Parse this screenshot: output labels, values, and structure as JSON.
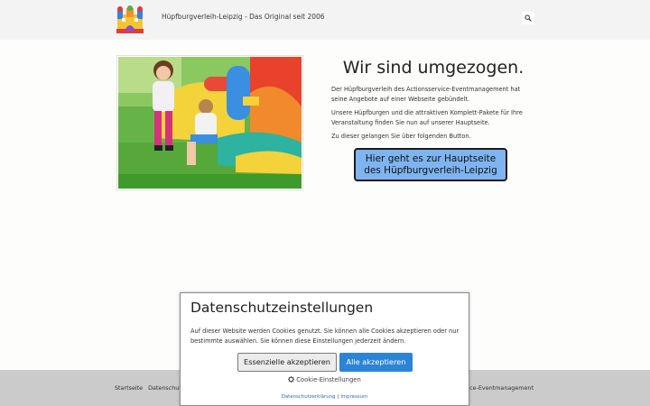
{
  "header": {
    "site_title": "Hüpfburgverleih-Leipzig - Das Original seit 2006",
    "search_icon": "search-icon"
  },
  "main": {
    "image": "bouncy-castle-children-photo",
    "headline": "Wir sind umgezogen.",
    "paragraph1": "Der Hüpfburgverleih des Actionsservice-Eventmanagement hat seine Angebote auf einer Webseite gebündelt.",
    "paragraph2": "Unsere Hüpfburgen und die attraktiven Komplett-Pakete für Ihre Veranstaltung finden Sie nun auf unserer Hauptseite.",
    "paragraph3": "Zu dieser gelangen Sie über folgenden Button.",
    "cta_label": "Hier geht es zur Hauptseite des Hüpfburgverleih-Leipzig",
    "cta_color": "#7eb4f0"
  },
  "footer": {
    "link_home": "Startseite",
    "link_privacy_partial": "Datenschutz",
    "right_text_partial": "ervice-Eventmanagement"
  },
  "cookie_dialog": {
    "title": "Datenschutzeinstellungen",
    "text": "Auf dieser Website werden Cookies genutzt. Sie können alle Cookies akzeptieren oder nur bestimmte auswählen. Sie können diese Einstellungen jederzeit ändern.",
    "essential_label": "Essenzielle akzeptieren",
    "accept_all_label": "Alle akzeptieren",
    "accept_all_color": "#2b84d6",
    "settings_label": "Cookie-Einstellungen",
    "privacy_link": "Datenschutzerklärung",
    "separator": "|",
    "imprint_link": "Impressum"
  }
}
